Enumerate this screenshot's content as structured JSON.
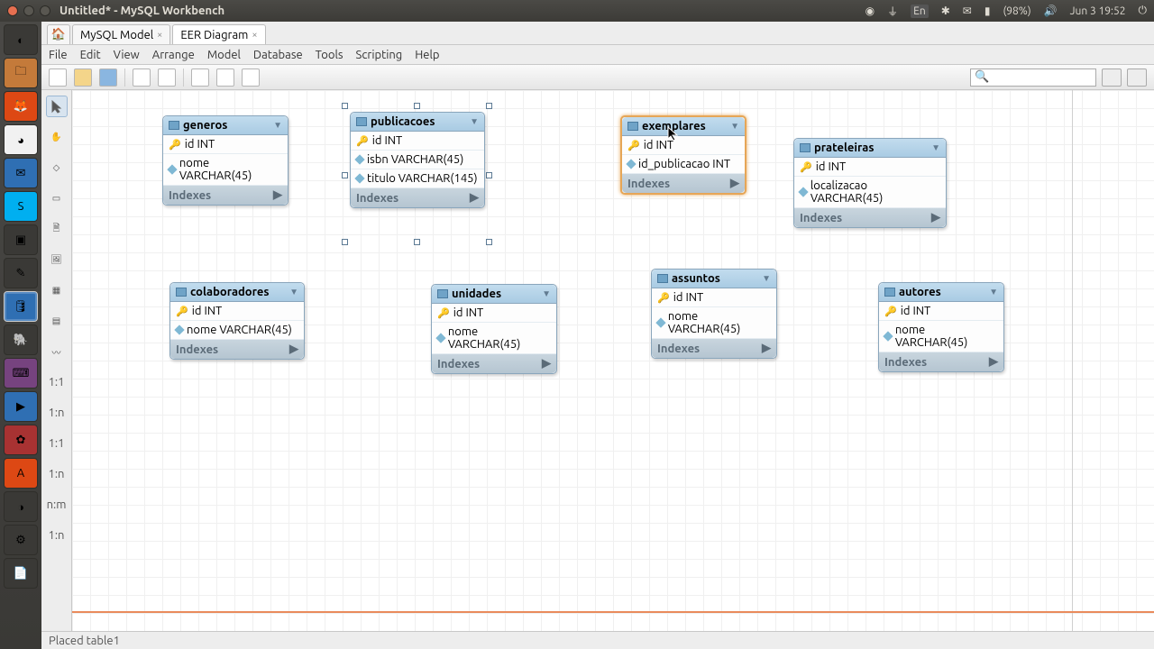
{
  "os": {
    "title": "Untitled* - MySQL Workbench",
    "lang": "En",
    "battery": "(98%)",
    "time": "Jun 3 19:52"
  },
  "tabs": {
    "model": "MySQL Model",
    "eer": "EER Diagram"
  },
  "menu": {
    "file": "File",
    "edit": "Edit",
    "view": "View",
    "arrange": "Arrange",
    "model": "Model",
    "database": "Database",
    "tools": "Tools",
    "scripting": "Scripting",
    "help": "Help"
  },
  "indexes_label": "Indexes",
  "tables": {
    "generos": {
      "name": "generos",
      "c0": "id INT",
      "c1": "nome VARCHAR(45)"
    },
    "publicacoes": {
      "name": "publicacoes",
      "c0": "id INT",
      "c1": "isbn VARCHAR(45)",
      "c2": "titulo VARCHAR(145)"
    },
    "exemplares": {
      "name": "exemplares",
      "c0": "id INT",
      "c1": "id_publicacao INT"
    },
    "prateleiras": {
      "name": "prateleiras",
      "c0": "id INT",
      "c1": "localizacao VARCHAR(45)"
    },
    "colaboradores": {
      "name": "colaboradores",
      "c0": "id INT",
      "c1": "nome VARCHAR(45)"
    },
    "unidades": {
      "name": "unidades",
      "c0": "id INT",
      "c1": "nome VARCHAR(45)"
    },
    "assuntos": {
      "name": "assuntos",
      "c0": "id INT",
      "c1": "nome VARCHAR(45)"
    },
    "autores": {
      "name": "autores",
      "c0": "id INT",
      "c1": "nome VARCHAR(45)"
    }
  },
  "side_tools": {
    "r11": "1:1",
    "r1na": "1:n",
    "r11b": "1:1",
    "r1nb": "1:n",
    "rnm": "n:m",
    "r1nc": "1:n"
  },
  "status": "Placed table1"
}
